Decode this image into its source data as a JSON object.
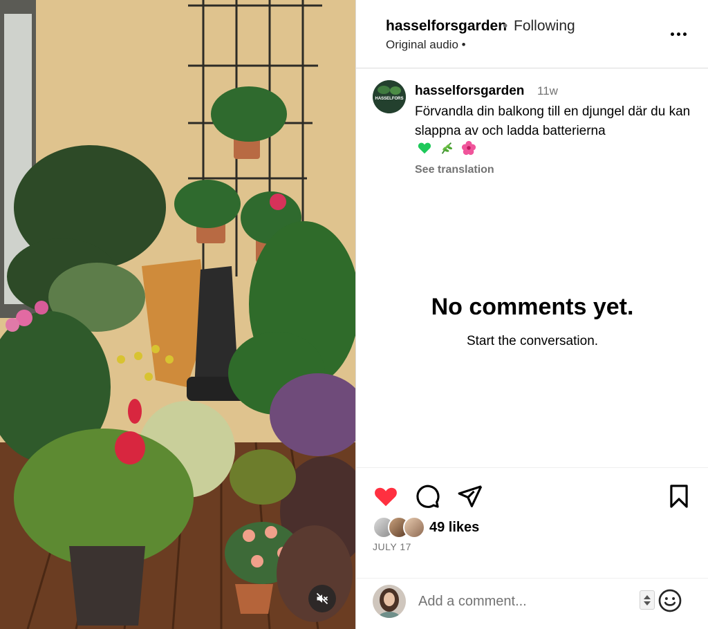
{
  "post": {
    "username": "hasselforsgarden",
    "separator": "•",
    "follow_status": "Following",
    "audio": "Original audio •",
    "more_icon": "more-horizontal-icon"
  },
  "caption": {
    "username": "hasselforsgarden",
    "time_ago": "11w",
    "text": "Förvandla din balkong till en djungel där du kan slappna av och ladda batterierna",
    "emojis": [
      "green-heart-emoji",
      "herb-emoji",
      "hibiscus-emoji"
    ],
    "see_translation": "See translation",
    "avatar_text": "HASSELFORS"
  },
  "comments": {
    "empty_title": "No comments yet.",
    "empty_subtitle": "Start the conversation."
  },
  "actions": {
    "like_icon": "heart-filled-icon",
    "like_color": "#ff3040",
    "comment_icon": "comment-icon",
    "share_icon": "send-icon",
    "save_icon": "bookmark-icon",
    "likes": "49 likes",
    "date": "JULY 17"
  },
  "comment_input": {
    "placeholder": "Add a comment...",
    "value": "",
    "emoji_icon": "emoji-smile-icon"
  },
  "media": {
    "mute_icon": "speaker-muted-icon"
  }
}
